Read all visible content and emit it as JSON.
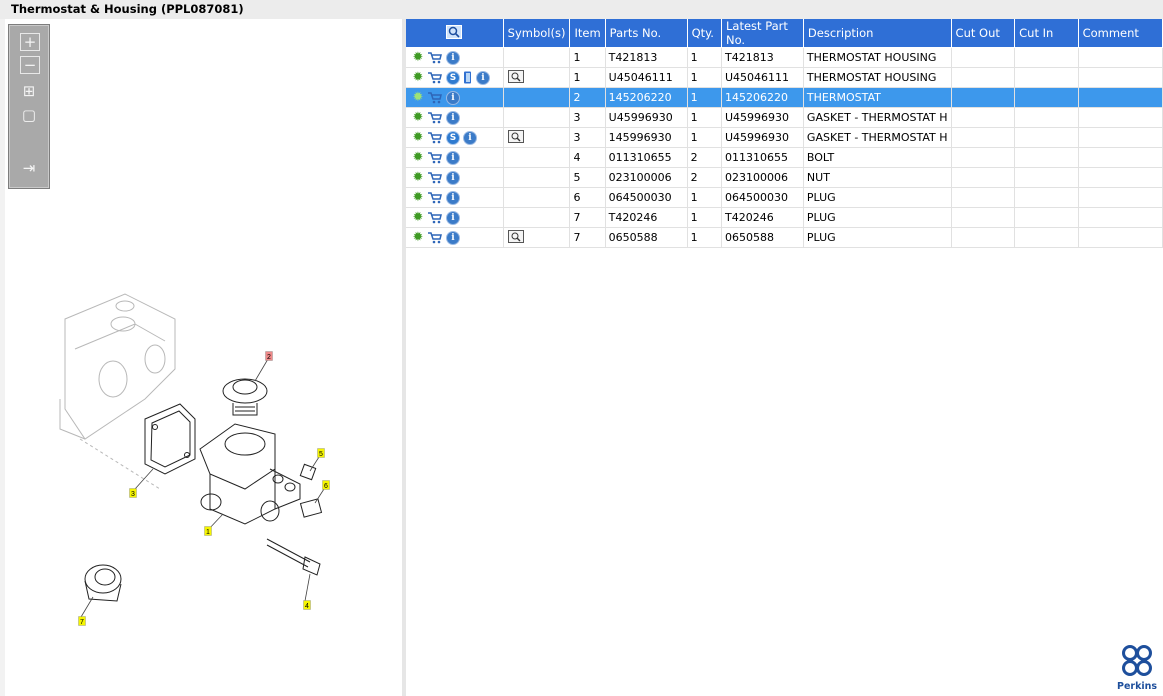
{
  "window": {
    "title": "Thermostat & Housing (PPL087081)"
  },
  "toolbar": {
    "buttons": [
      {
        "name": "zoom-in",
        "glyph": "+"
      },
      {
        "name": "zoom-out",
        "glyph": "−"
      },
      {
        "name": "fit-all",
        "glyph": "⊞"
      },
      {
        "name": "fit-selection",
        "glyph": "▢"
      },
      {
        "name": "export",
        "glyph": "⇥"
      }
    ]
  },
  "diagram": {
    "callouts": [
      {
        "label": "1",
        "color": "#f5f500"
      },
      {
        "label": "2",
        "color": "#f08a8a"
      },
      {
        "label": "3",
        "color": "#f5f500"
      },
      {
        "label": "4",
        "color": "#f5f500"
      },
      {
        "label": "5",
        "color": "#f5f500"
      },
      {
        "label": "6",
        "color": "#f5f500"
      },
      {
        "label": "7",
        "color": "#f5f500"
      }
    ]
  },
  "table": {
    "columns": [
      "",
      "Symbol(s)",
      "Item",
      "Parts No.",
      "Qty.",
      "Latest Part No.",
      "Description",
      "Cut Out",
      "Cut In",
      "Comment"
    ],
    "rows": [
      {
        "icons": [
          "gear",
          "cart",
          "info"
        ],
        "symbol": "",
        "item": "1",
        "part": "T421813",
        "qty": "1",
        "latest": "T421813",
        "desc": "THERMOSTAT HOUSING",
        "cut_out": "",
        "cut_in": "",
        "comment": ""
      },
      {
        "icons": [
          "gear",
          "cart",
          "s",
          "book",
          "info"
        ],
        "symbol": "view",
        "item": "1",
        "part": "U45046111",
        "qty": "1",
        "latest": "U45046111",
        "desc": "THERMOSTAT HOUSING",
        "cut_out": "",
        "cut_in": "",
        "comment": ""
      },
      {
        "icons": [
          "gear",
          "cart",
          "info"
        ],
        "symbol": "",
        "item": "2",
        "part": "145206220",
        "qty": "1",
        "latest": "145206220",
        "desc": "THERMOSTAT",
        "cut_out": "",
        "cut_in": "",
        "comment": "",
        "selected": true
      },
      {
        "icons": [
          "gear",
          "cart",
          "info"
        ],
        "symbol": "",
        "item": "3",
        "part": "U45996930",
        "qty": "1",
        "latest": "U45996930",
        "desc": "GASKET - THERMOSTAT H",
        "cut_out": "",
        "cut_in": "",
        "comment": ""
      },
      {
        "icons": [
          "gear",
          "cart",
          "s",
          "info"
        ],
        "symbol": "view",
        "item": "3",
        "part": "145996930",
        "qty": "1",
        "latest": "U45996930",
        "desc": "GASKET - THERMOSTAT H",
        "cut_out": "",
        "cut_in": "",
        "comment": ""
      },
      {
        "icons": [
          "gear",
          "cart",
          "info"
        ],
        "symbol": "",
        "item": "4",
        "part": "011310655",
        "qty": "2",
        "latest": "011310655",
        "desc": "BOLT",
        "cut_out": "",
        "cut_in": "",
        "comment": ""
      },
      {
        "icons": [
          "gear",
          "cart",
          "info"
        ],
        "symbol": "",
        "item": "5",
        "part": "023100006",
        "qty": "2",
        "latest": "023100006",
        "desc": "NUT",
        "cut_out": "",
        "cut_in": "",
        "comment": ""
      },
      {
        "icons": [
          "gear",
          "cart",
          "info"
        ],
        "symbol": "",
        "item": "6",
        "part": "064500030",
        "qty": "1",
        "latest": "064500030",
        "desc": "PLUG",
        "cut_out": "",
        "cut_in": "",
        "comment": ""
      },
      {
        "icons": [
          "gear",
          "cart",
          "info"
        ],
        "symbol": "",
        "item": "7",
        "part": "T420246",
        "qty": "1",
        "latest": "T420246",
        "desc": "PLUG",
        "cut_out": "",
        "cut_in": "",
        "comment": ""
      },
      {
        "icons": [
          "gear",
          "cart",
          "info"
        ],
        "symbol": "view",
        "item": "7",
        "part": "0650588",
        "qty": "1",
        "latest": "0650588",
        "desc": "PLUG",
        "cut_out": "",
        "cut_in": "",
        "comment": ""
      }
    ]
  },
  "brand": {
    "name": "Perkins",
    "color": "#1e4f9c"
  },
  "colors": {
    "header": "#2f6fd6",
    "selected_row": "#3d98ec",
    "gear": "#3f9a24"
  }
}
